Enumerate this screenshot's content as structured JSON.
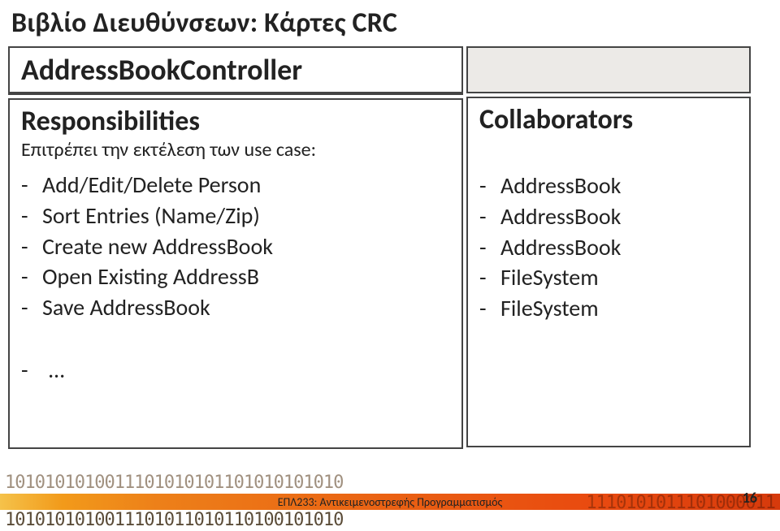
{
  "title": "Βιβλίο Διευθύνσεων: Κάρτες CRC",
  "crc": {
    "className": "AddressBookController",
    "responsibilities": {
      "header": "Responsibilities",
      "subtitle": "Επιτρέπει την εκτέλεση των use case:",
      "items": [
        "Add/Edit/Delete Person",
        "Sort Entries (Name/Zip)",
        "Create new AddressBook",
        "Open Existing AddressB",
        "Save AddressBook"
      ],
      "ellipsis": "…"
    },
    "collaborators": {
      "header": "Collaborators",
      "items": [
        "AddressBook",
        "AddressBook",
        "AddressBook",
        "FileSystem",
        "FileSystem"
      ]
    }
  },
  "footer": {
    "bits_top": "1010101010011101010101101010101010",
    "bits_bottom": "1010101010011101011010110100101010",
    "bits_back": "1110101011101000011",
    "course": "ΕΠΛ233: Αντικειμενοστρεφής Προγραμματισμός",
    "page": "16"
  }
}
